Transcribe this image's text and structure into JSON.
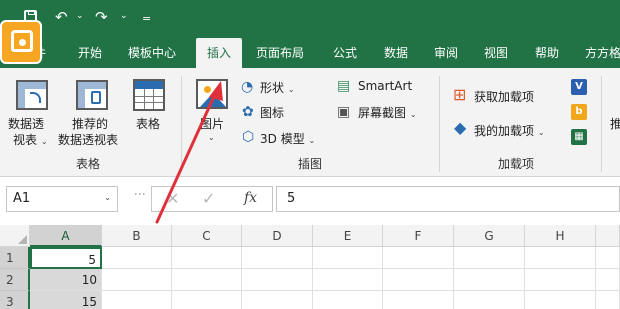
{
  "quick_access": {
    "undo": "↶",
    "redo": "↷",
    "more": "="
  },
  "tabs": [
    "件",
    "开始",
    "模板中心",
    "插入",
    "页面布局",
    "公式",
    "数据",
    "审阅",
    "视图",
    "帮助",
    "方方格"
  ],
  "ribbon": {
    "tables_group": {
      "label": "表格",
      "pivot_label_1": "数据透",
      "pivot_label_2": "视表",
      "recommended_label_1": "推荐的",
      "recommended_label_2": "数据透视表",
      "table_label": "表格"
    },
    "illustrations_group": {
      "label": "插图",
      "picture_label": "图片",
      "shapes_label": "形状",
      "icons_label": "图标",
      "model3d_label": "3D 模型",
      "smartart_label": "SmartArt",
      "screenshot_label": "屏幕截图"
    },
    "addins_group": {
      "label": "加载项",
      "get_addins_label": "获取加载项",
      "my_addins_label": "我的加载项"
    },
    "partial_label": "推"
  },
  "formula_bar": {
    "name_box": "A1",
    "fx": "fx",
    "value": "5"
  },
  "grid": {
    "columns": [
      "A",
      "B",
      "C",
      "D",
      "E",
      "F",
      "G",
      "H"
    ],
    "rows": [
      {
        "num": "1",
        "a": "5"
      },
      {
        "num": "2",
        "a": "10"
      },
      {
        "num": "3",
        "a": "15"
      }
    ]
  },
  "colors": {
    "brand": "#217346",
    "accent_arrow": "#e0303a"
  }
}
